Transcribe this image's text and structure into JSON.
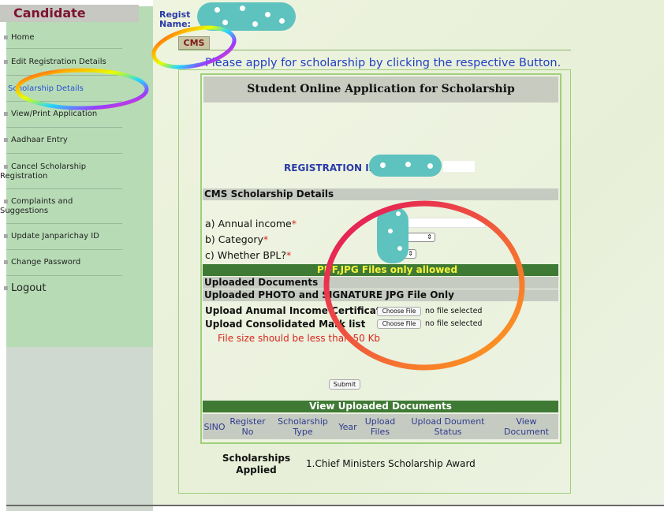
{
  "sidebar": {
    "title": "Candidate",
    "items": [
      {
        "label": "Home"
      },
      {
        "label": "Edit Registration Details"
      },
      {
        "label": "Scholarship Details"
      },
      {
        "label": "View/Print Application"
      },
      {
        "label": "Aadhaar Entry"
      },
      {
        "label": "Cancel Scholarship Registration"
      },
      {
        "label": "Complaints and Suggestions"
      },
      {
        "label": "Update Janparichay ID"
      },
      {
        "label": "Change Password"
      },
      {
        "label": "Logout"
      }
    ]
  },
  "header": {
    "reg_label": "Regist Name:"
  },
  "tabs": [
    {
      "label": "CMS"
    }
  ],
  "notice": "Please apply for scholarship by clicking the respective Button.",
  "form": {
    "title": "Student Online Application for Scholarship",
    "registration_id_label": "REGISTRATION ID-",
    "section_title": "CMS Scholarship Details",
    "fields": {
      "annual_income": "a) Annual income",
      "category": "b) Category",
      "bpl": "c) Whether BPL?",
      "required_mark": "*"
    },
    "file_notice": "PDF,JPG Files only allowed",
    "uploaded_documents": "Uploaded Documents",
    "uploaded_photo_sig": "Uploaded PHOTO and SIGNATURE JPG File Only",
    "uploads": [
      {
        "label": "Upload Anumal Income Certificate",
        "button": "Choose File",
        "status": "no file selected"
      },
      {
        "label": "Upload Consolidated Mark list",
        "button": "Choose File",
        "status": "no file selected"
      }
    ],
    "size_warning": "File size should be less than 50 Kb",
    "submit_label": "Submit"
  },
  "view_docs": {
    "title": "View Uploaded Documents",
    "columns": [
      "SINO",
      "Register No",
      "Scholarship Type",
      "Year",
      "Upload Files",
      "Upload Doument Status",
      "View Document"
    ]
  },
  "applied": {
    "label": "Scholarships Applied",
    "value": "1.Chief Ministers Scholarship Award"
  },
  "colors": {
    "sidebar_bg": "#b7dcb5",
    "title_maroon": "#7d1333",
    "link_blue": "#1f3fc0",
    "section_green": "#3f7a35",
    "warning_red": "#d8261d",
    "redaction_teal": "#5ec2bf"
  }
}
